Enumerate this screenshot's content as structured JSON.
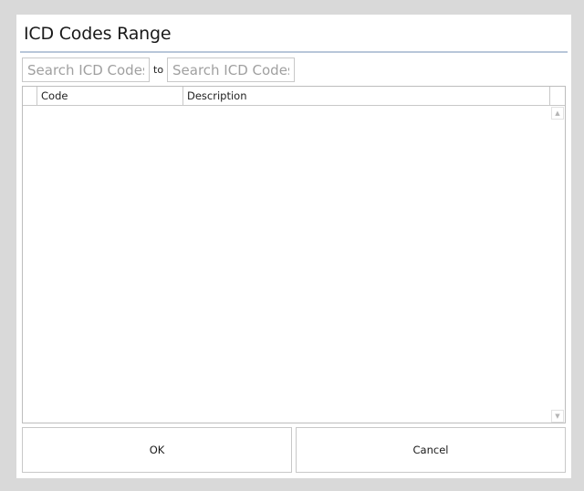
{
  "dialog": {
    "title": "ICD Codes Range"
  },
  "search": {
    "from_placeholder": "Search ICD Codes",
    "to_placeholder": "Search ICD Codes",
    "to_label": "to"
  },
  "grid": {
    "columns": [
      "Code",
      "Description"
    ],
    "rows": []
  },
  "icons": {
    "scroll_up": "scroll-up-arrow-icon",
    "scroll_down": "scroll-down-arrow-icon"
  },
  "buttons": {
    "ok_label": "OK",
    "cancel_label": "Cancel"
  }
}
